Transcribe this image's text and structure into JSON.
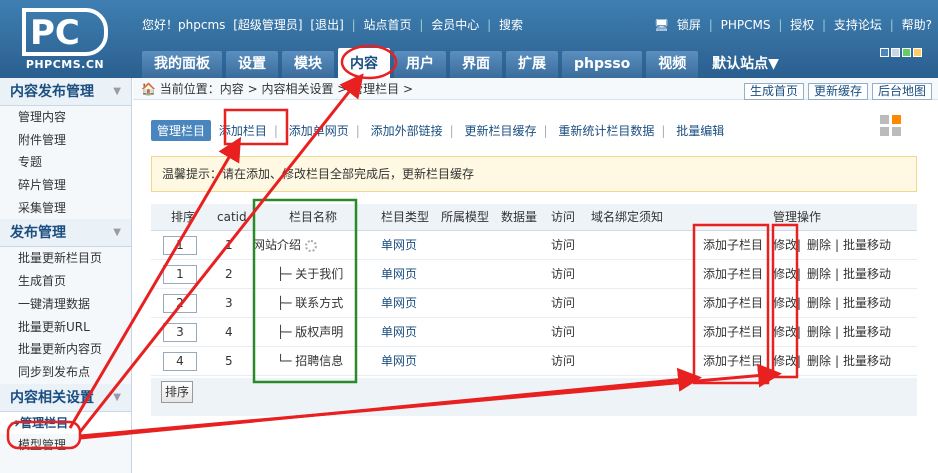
{
  "logo": {
    "mark": "PC",
    "domain": "PHPCMS.CN"
  },
  "topbar": {
    "greeting": "您好！phpcms",
    "role": "[超级管理员]",
    "logout": "[退出]",
    "links": [
      "站点首页",
      "会员中心",
      "搜索"
    ]
  },
  "topright": {
    "items": [
      "锁屏",
      "PHPCMS",
      "授权",
      "支持论坛",
      "帮助?"
    ]
  },
  "nav": {
    "tabs": [
      "我的面板",
      "设置",
      "模块",
      "内容",
      "用户",
      "界面",
      "扩展",
      "phpsso",
      "视频"
    ],
    "active": "内容",
    "site_selector": "默认站点"
  },
  "colors": {
    "accent": "#2a5f8f",
    "highlight_red": "#e82020",
    "highlight_green": "#2a8a2a",
    "tips_bg": "#fff9e3"
  },
  "sidebar": {
    "groups": [
      {
        "title": "内容发布管理",
        "items": [
          "管理内容",
          "附件管理",
          "专题",
          "碎片管理",
          "采集管理"
        ]
      },
      {
        "title": "发布管理",
        "items": [
          "批量更新栏目页",
          "生成首页",
          "一键清理数据",
          "批量更新URL",
          "批量更新内容页",
          "同步到发布点"
        ]
      },
      {
        "title": "内容相关设置",
        "items": [
          "管理栏目",
          "模型管理"
        ]
      }
    ],
    "active_item": "管理栏目"
  },
  "breadcrumb": {
    "text": "当前位置：内容 > 内容相关设置 > 管理栏目 >",
    "buttons": [
      "生成首页",
      "更新缓存",
      "后台地图"
    ]
  },
  "subnav": {
    "items": [
      "管理栏目",
      "添加栏目",
      "添加单网页",
      "添加外部链接",
      "更新栏目缓存",
      "重新统计栏目数据",
      "批量编辑"
    ],
    "current": "管理栏目"
  },
  "tips": {
    "text": "温馨提示：请在添加、修改栏目全部完成后，更新栏目缓存"
  },
  "table": {
    "headers": [
      "排序",
      "catid",
      "栏目名称",
      "栏目类型",
      "所属模型",
      "数据量",
      "访问",
      "域名绑定须知",
      "管理操作"
    ],
    "rows": [
      {
        "order": "1",
        "catid": "1",
        "name": "网站介绍",
        "type": "单网页",
        "model": "",
        "count": "",
        "visit": "访问",
        "add_child": "添加子栏目",
        "edit": "修改",
        "delete": "删除",
        "move": "批量移动"
      },
      {
        "order": "1",
        "catid": "2",
        "name": "├─ 关于我们",
        "type": "单网页",
        "model": "",
        "count": "",
        "visit": "访问",
        "add_child": "添加子栏目",
        "edit": "修改",
        "delete": "删除",
        "move": "批量移动"
      },
      {
        "order": "2",
        "catid": "3",
        "name": "├─ 联系方式",
        "type": "单网页",
        "model": "",
        "count": "",
        "visit": "访问",
        "add_child": "添加子栏目",
        "edit": "修改",
        "delete": "删除",
        "move": "批量移动"
      },
      {
        "order": "3",
        "catid": "4",
        "name": "├─ 版权声明",
        "type": "单网页",
        "model": "",
        "count": "",
        "visit": "访问",
        "add_child": "添加子栏目",
        "edit": "修改",
        "delete": "删除",
        "move": "批量移动"
      },
      {
        "order": "4",
        "catid": "5",
        "name": "└─ 招聘信息",
        "type": "单网页",
        "model": "",
        "count": "",
        "visit": "访问",
        "add_child": "添加子栏目",
        "edit": "修改",
        "delete": "删除",
        "move": "批量移动"
      }
    ],
    "sort_button": "排序"
  }
}
